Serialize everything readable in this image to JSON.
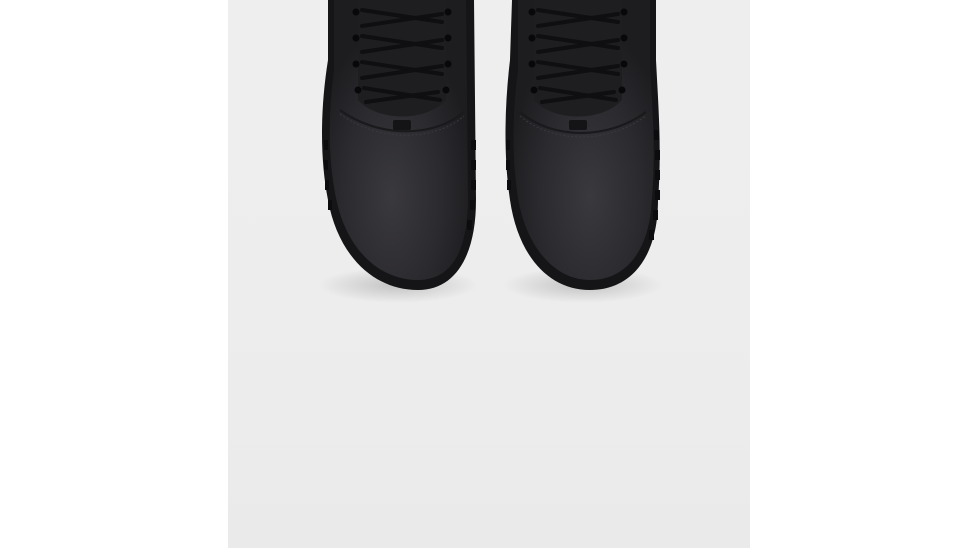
{
  "image": {
    "subject": "pair-of-black-leather-lace-up-boots-top-view",
    "colors": {
      "background": "#ffffff",
      "frame": "#ededed",
      "leather": "#2a292d",
      "leather_highlight": "#3a393e",
      "sole": "#151416",
      "laces": "#1b1a1c"
    }
  }
}
